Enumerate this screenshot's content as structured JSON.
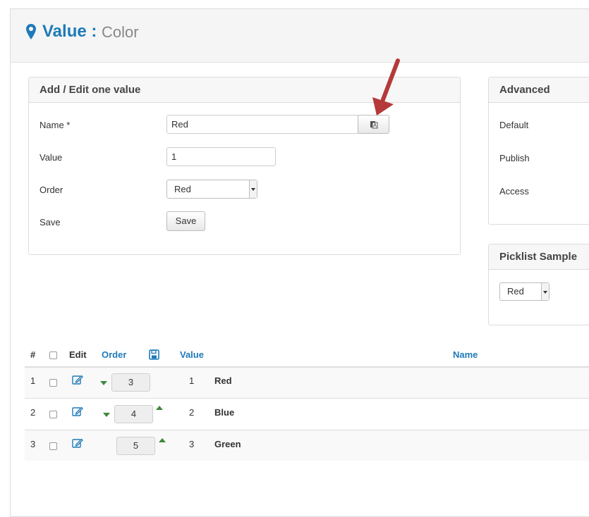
{
  "header": {
    "title_main": "Value :",
    "title_sub": "Color"
  },
  "edit_panel": {
    "title": "Add / Edit one value",
    "name_label": "Name *",
    "name_value": "Red",
    "value_label": "Value",
    "value_value": "1",
    "order_label": "Order",
    "order_selected": "Red",
    "save_label": "Save",
    "save_button": "Save"
  },
  "advanced_panel": {
    "title": "Advanced",
    "default_label": "Default",
    "publish_label": "Publish",
    "access_label": "Access"
  },
  "picklist_panel": {
    "title": "Picklist Sample",
    "selected": "Red"
  },
  "table": {
    "headers": {
      "num": "#",
      "edit": "Edit",
      "order": "Order",
      "value": "Value",
      "name": "Name"
    },
    "rows": [
      {
        "num": "1",
        "order": "3",
        "value": "1",
        "name": "Red"
      },
      {
        "num": "2",
        "order": "4",
        "value": "2",
        "name": "Blue"
      },
      {
        "num": "3",
        "order": "5",
        "value": "3",
        "name": "Green"
      }
    ]
  },
  "colors": {
    "accent_blue": "#1e7ab8",
    "arrow_red": "#b5393a",
    "order_arrow_green": "#3c8a3c"
  },
  "icons": {
    "header": "map-marker-icon",
    "translate": "translate-flag-icon",
    "edit": "edit-pencil-icon",
    "save_order": "floppy-disk-icon"
  }
}
